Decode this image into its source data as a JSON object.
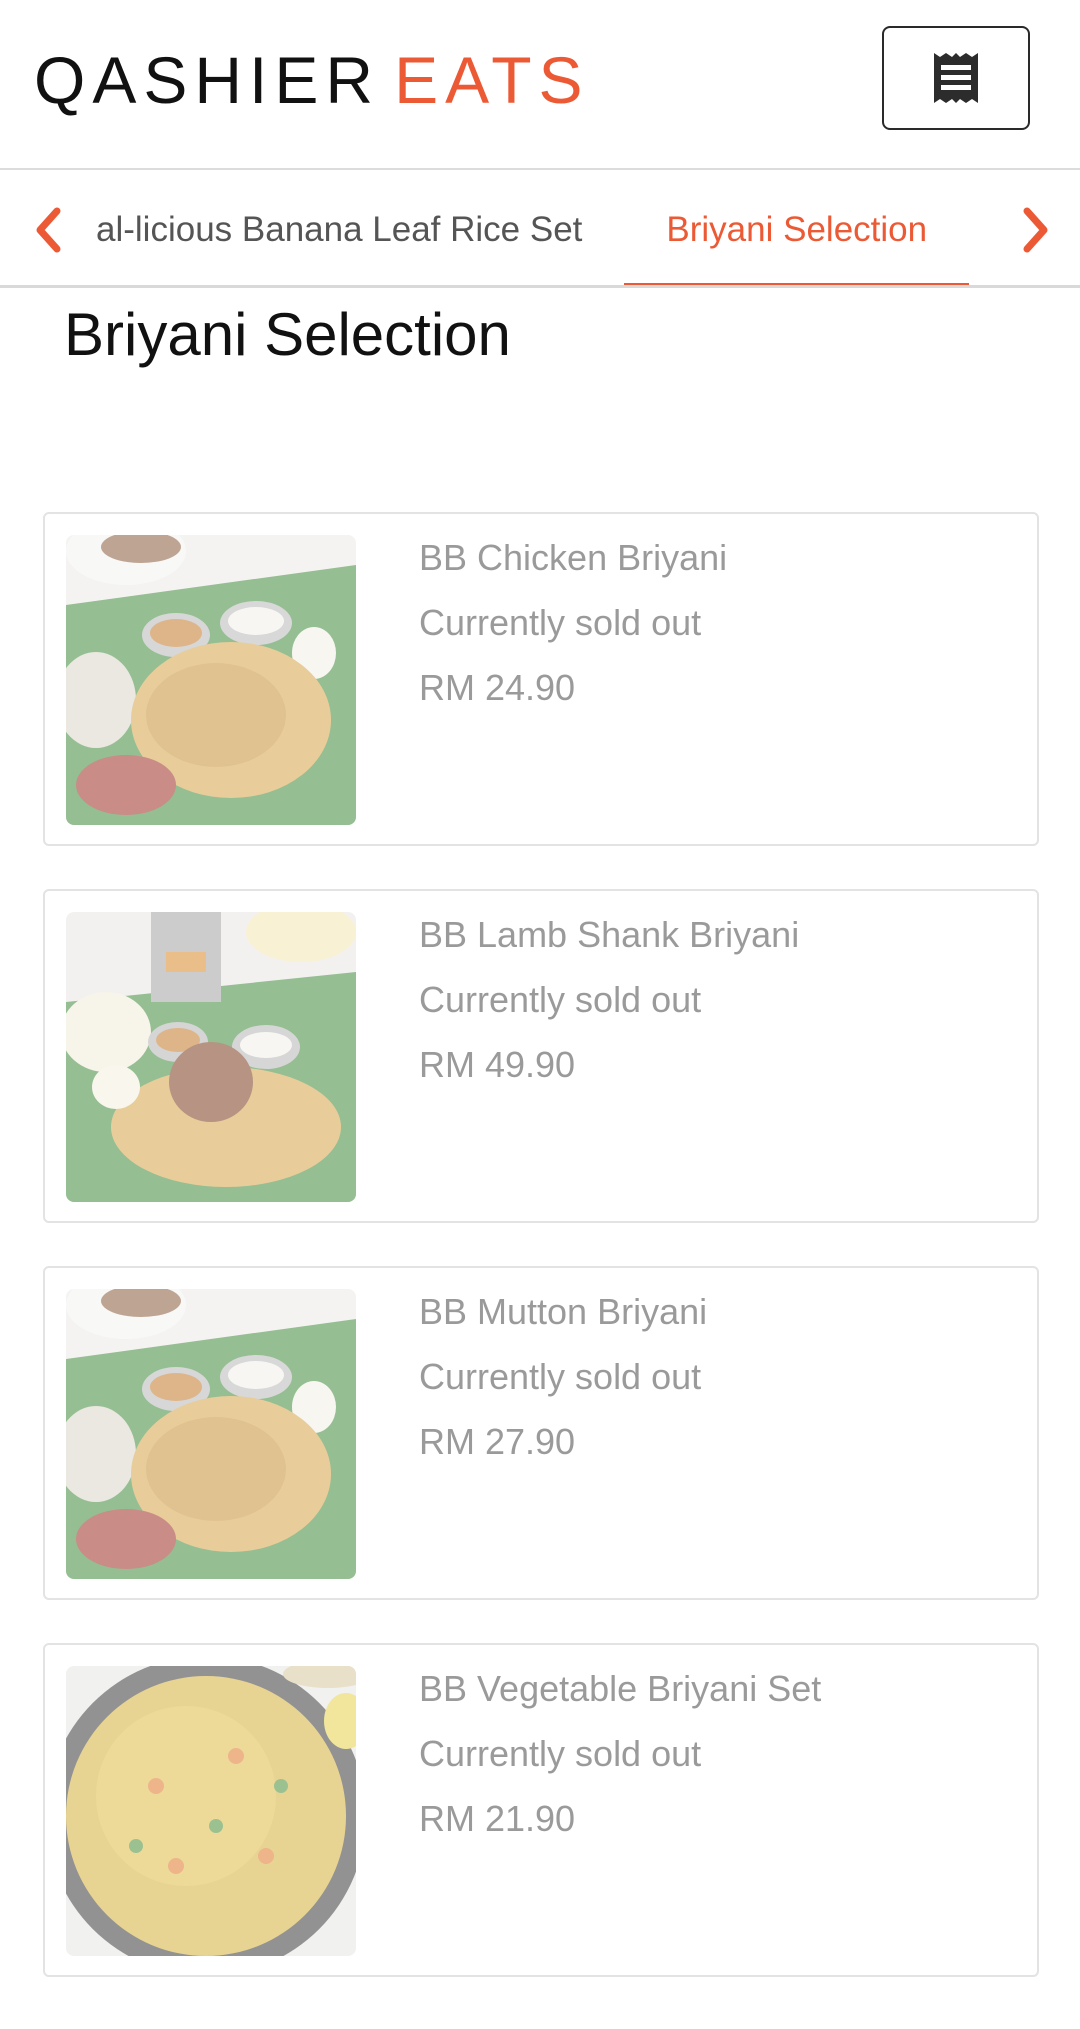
{
  "header": {
    "logo_part1": "QASHIER",
    "logo_part2": "EATS",
    "menu_icon": "receipt-icon"
  },
  "categories": {
    "prev_icon": "chevron-left-icon",
    "next_icon": "chevron-right-icon",
    "tabs": [
      {
        "label": "al-licious Banana Leaf Rice Set"
      },
      {
        "label": "Briyani Selection",
        "active": true
      }
    ]
  },
  "section": {
    "title": "Briyani Selection"
  },
  "items": [
    {
      "name": "BB Chicken Briyani",
      "status": "Currently sold out",
      "price": "RM 24.90"
    },
    {
      "name": "BB Lamb Shank Briyani",
      "status": "Currently sold out",
      "price": "RM 49.90"
    },
    {
      "name": "BB Mutton Briyani",
      "status": "Currently sold out",
      "price": "RM 27.90"
    },
    {
      "name": "BB Vegetable Briyani Set",
      "status": "Currently sold out",
      "price": "RM 21.90"
    }
  ],
  "colors": {
    "accent": "#ec5a35",
    "sold_out_text": "#9a9a9a"
  }
}
